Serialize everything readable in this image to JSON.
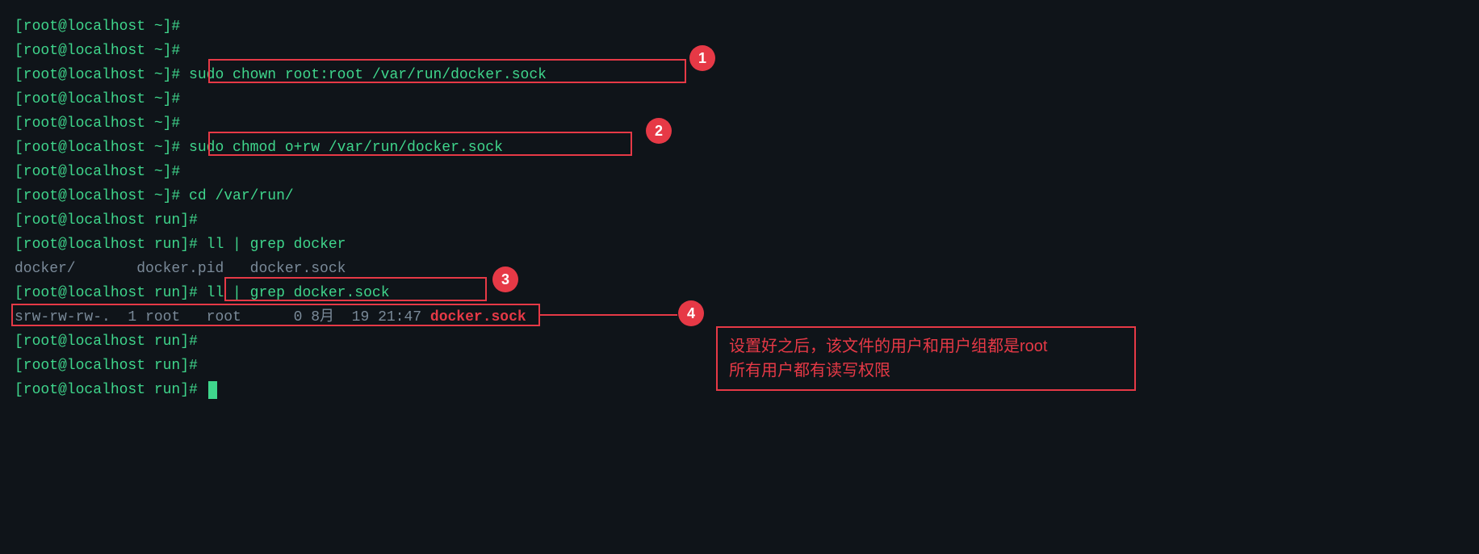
{
  "prompts": {
    "home": "[root@localhost ~]#",
    "run": "[root@localhost run]#"
  },
  "lines": [
    {
      "prompt": "home",
      "cmd": ""
    },
    {
      "prompt": "home",
      "cmd": ""
    },
    {
      "prompt": "home",
      "cmd": "sudo chown root:root /var/run/docker.sock"
    },
    {
      "prompt": "home",
      "cmd": ""
    },
    {
      "prompt": "home",
      "cmd": ""
    },
    {
      "prompt": "home",
      "cmd": "sudo chmod o+rw /var/run/docker.sock"
    },
    {
      "prompt": "home",
      "cmd": ""
    },
    {
      "prompt": "home",
      "cmd": "cd /var/run/"
    },
    {
      "prompt": "run",
      "cmd": ""
    },
    {
      "prompt": "run",
      "cmd": "ll | grep docker"
    }
  ],
  "output1_parts": [
    "docker/       docker.pid   docker.sock"
  ],
  "line11": {
    "prompt": "run",
    "cmd": "ll | grep docker.sock"
  },
  "output2_prefix": "srw-rw-rw-.  1 root   root      0 8月  19 21:47 ",
  "output2_highlight": "docker.sock",
  "trailing": [
    {
      "prompt": "run",
      "cmd": ""
    },
    {
      "prompt": "run",
      "cmd": ""
    },
    {
      "prompt": "run",
      "cmd": "",
      "cursor": true
    }
  ],
  "badges": {
    "b1": "1",
    "b2": "2",
    "b3": "3",
    "b4": "4"
  },
  "callout": {
    "line1": "设置好之后，该文件的用户和用户组都是root",
    "line2": "所有用户都有读写权限"
  }
}
